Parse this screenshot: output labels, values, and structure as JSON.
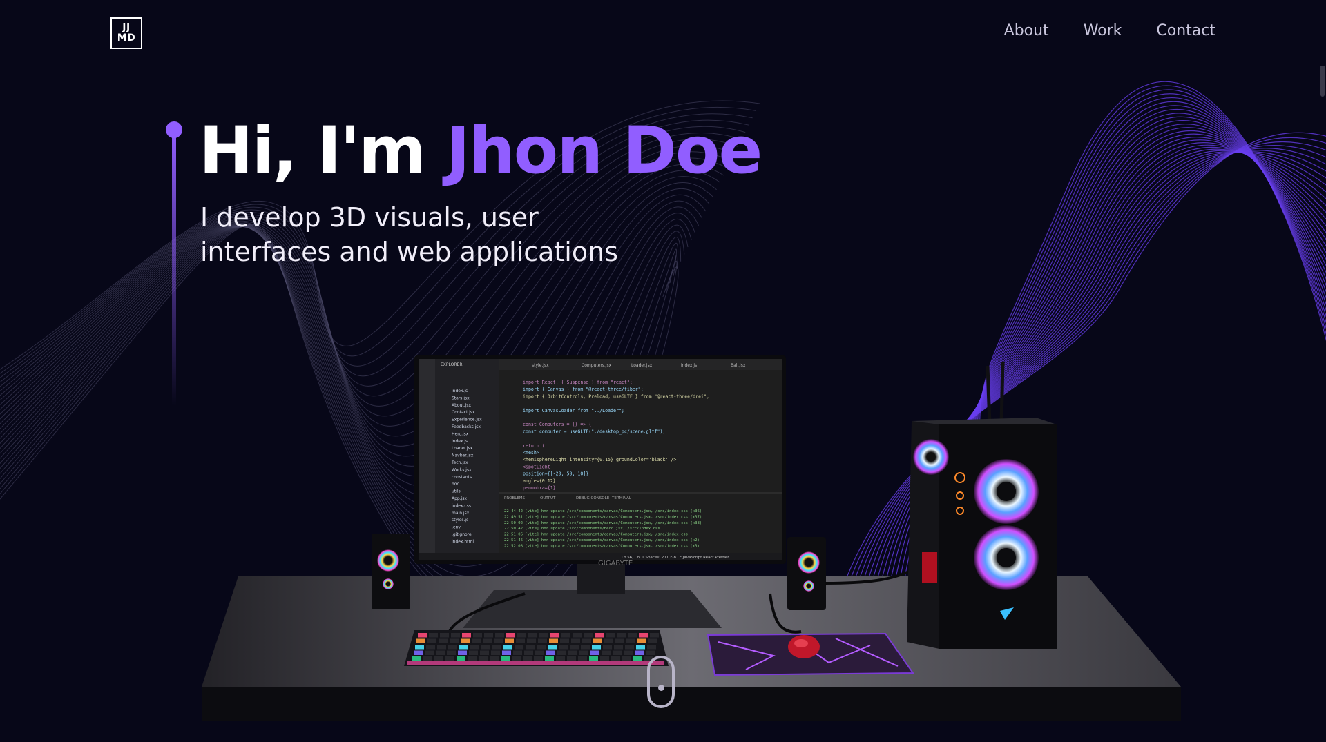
{
  "logo": {
    "line1": "JJ",
    "line2": "MD"
  },
  "nav": {
    "items": [
      "About",
      "Work",
      "Contact"
    ]
  },
  "hero": {
    "greeting": "Hi, I'm ",
    "name": "Jhon Doe",
    "tagline_line1": "I develop 3D visuals, user",
    "tagline_line2": "interfaces and web applications"
  },
  "monitor": {
    "brand": "GIGABYTE",
    "tabs": [
      "style.jsx",
      "Computers.jsx",
      "Loader.jsx",
      "index.js",
      "Ball.jsx"
    ],
    "panel_tabs": [
      "PROBLEMS",
      "OUTPUT",
      "DEBUG CONSOLE",
      "TERMINAL"
    ],
    "explorer_title": "EXPLORER",
    "files": [
      "index.js",
      "Stars.jsx",
      "About.jsx",
      "Contact.jsx",
      "Experience.jsx",
      "Feedbacks.jsx",
      "Hero.jsx",
      "index.js",
      "Loader.jsx",
      "Navbar.jsx",
      "Tech.jsx",
      "Works.jsx",
      "constants",
      "hoc",
      "utils",
      "App.jsx",
      "index.css",
      "main.jsx",
      "styles.js",
      ".env",
      ".gitignore",
      "index.html"
    ],
    "code": [
      "import React, { Suspense } from \"react\";",
      "import { Canvas } from \"@react-three/fiber\";",
      "import { OrbitControls, Preload, useGLTF } from \"@react-three/drei\";",
      "",
      "import CanvasLoader from \"../Loader\";",
      "",
      "const Computers = () => {",
      "  const computer = useGLTF(\"./desktop_pc/scene.gltf\");",
      "",
      "  return (",
      "    <mesh>",
      "      <hemisphereLight intensity={0.15} groundColor='black' />",
      "      <spotLight",
      "        position={[-20, 50, 10]}",
      "        angle={0.12}",
      "        penumbra={1}"
    ],
    "terminal": [
      "22:44:42 [vite] hmr update /src/components/canvas/Computers.jsx, /src/index.css (x36)",
      "22:49:51 [vite] hmr update /src/components/canvas/Computers.jsx, /src/index.css (x37)",
      "22:50:02 [vite] hmr update /src/components/canvas/Computers.jsx, /src/index.css (x38)",
      "22:50:42 [vite] hmr update /src/components/Hero.jsx, /src/index.css",
      "22:51:06 [vite] hmr update /src/components/canvas/Computers.jsx, /src/index.css",
      "22:51:46 [vite] hmr update /src/components/canvas/Computers.jsx, /src/index.css (x2)",
      "22:52:08 [vite] hmr update /src/components/canvas/Computers.jsx, /src/index.css (x3)"
    ],
    "statusbar": "Ln 56, Col 1   Spaces: 2   UTF-8   LF   JavaScript React   Prettier"
  },
  "colors": {
    "accent": "#915eff",
    "background": "#070718",
    "nav_text": "#c9c6dd"
  }
}
